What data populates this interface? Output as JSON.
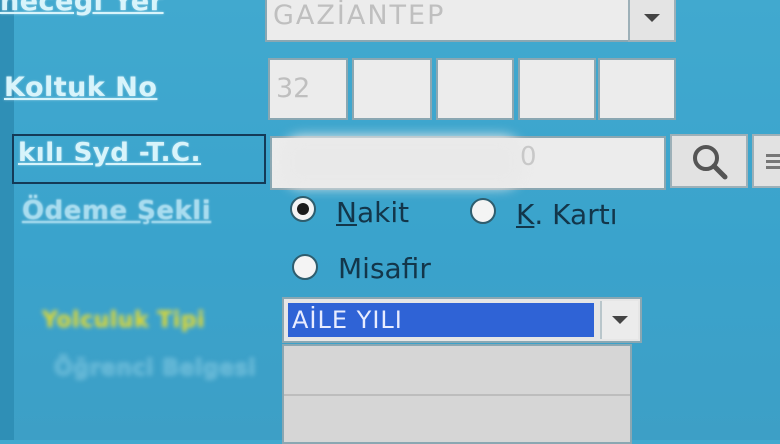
{
  "labels": {
    "destination": "neceği Yer",
    "seat_no": "Koltuk No",
    "tc": "kılı Syd -T.C.",
    "payment": "Ödeme Şekli",
    "campaign": "Yolculuk Tipi",
    "faint": "Öğrenci Belgesi"
  },
  "destination": {
    "value": "GAZİANTEP"
  },
  "seat_numbers": [
    "32",
    "",
    "",
    "",
    ""
  ],
  "tc": {
    "value": "",
    "suffix": "0"
  },
  "payment": {
    "options": [
      {
        "label": "Nakit",
        "selected": true
      },
      {
        "label": "K. Kartı",
        "selected": false
      },
      {
        "label": "Misafir",
        "selected": false
      }
    ]
  },
  "campaign": {
    "value": "AİLE YILI"
  },
  "icons": {
    "search": "search-icon",
    "list": "list-icon",
    "dropdown": "chevron-down-icon"
  },
  "colors": {
    "background": "#3aa3cc",
    "selection": "#2f63d6",
    "label": "#d8f4fb",
    "campaign_label": "#d7d430"
  }
}
